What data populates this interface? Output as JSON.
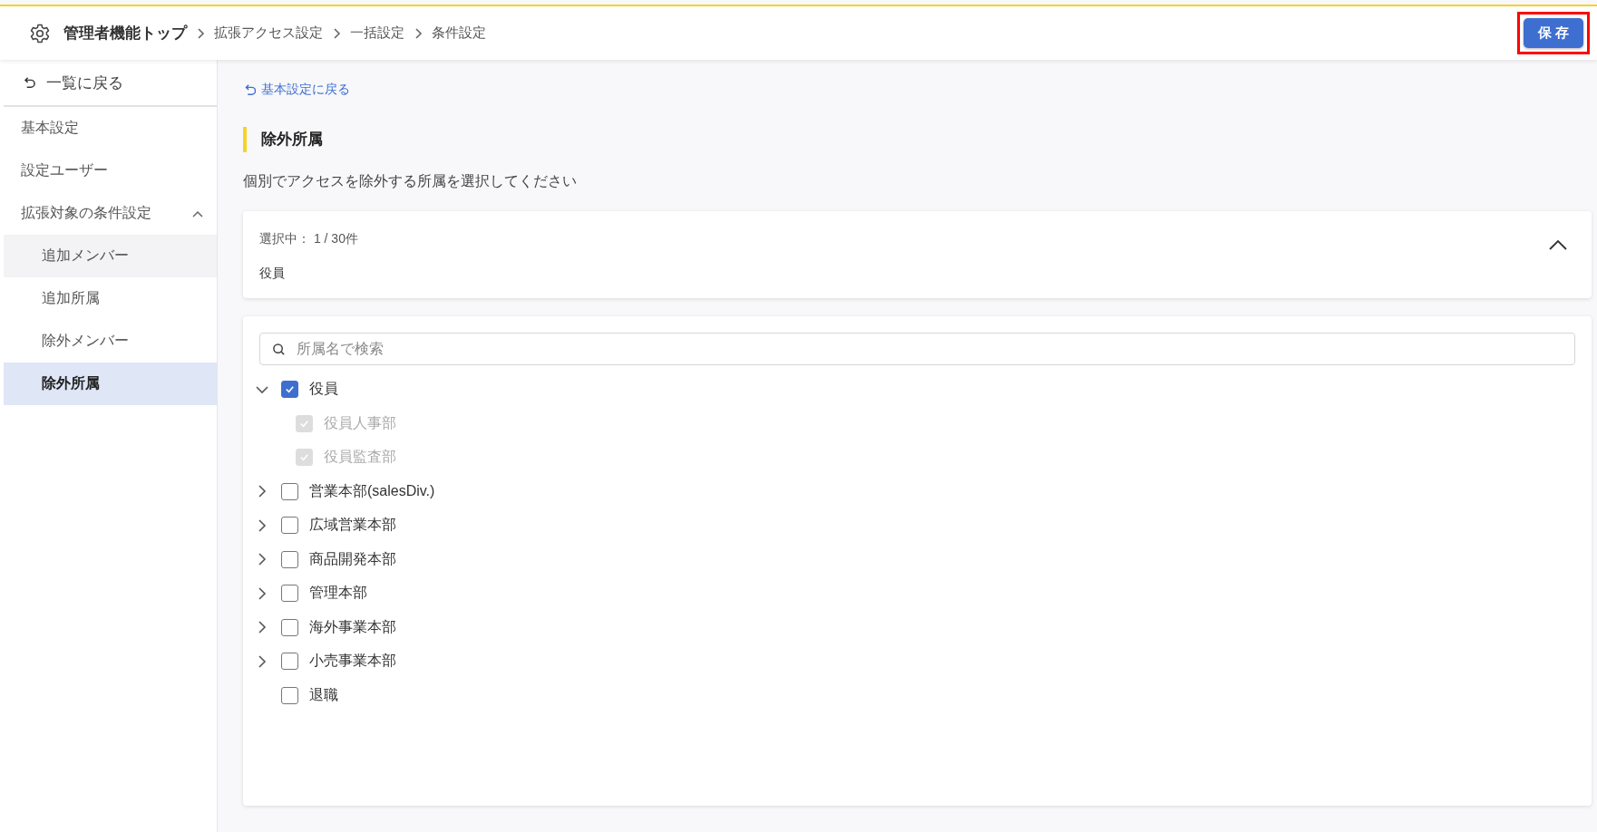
{
  "breadcrumb": [
    {
      "label": "管理者機能トップ",
      "bold": true
    },
    {
      "label": "拡張アクセス設定",
      "bold": false
    },
    {
      "label": "一括設定",
      "bold": false
    },
    {
      "label": "条件設定",
      "bold": false
    }
  ],
  "save_button": {
    "label": "保存",
    "highlighted": true
  },
  "sidebar": {
    "back_link": "一覧に戻る",
    "items": [
      {
        "label": "基本設定",
        "selected": false,
        "hovered": false
      },
      {
        "label": "設定ユーザー",
        "selected": false,
        "hovered": false
      },
      {
        "label": "拡張対象の条件設定",
        "selected": false,
        "hovered": false,
        "expanded": true,
        "children": [
          {
            "label": "追加メンバー",
            "selected": false,
            "hovered": true
          },
          {
            "label": "追加所属",
            "selected": false,
            "hovered": false
          },
          {
            "label": "除外メンバー",
            "selected": false,
            "hovered": false
          },
          {
            "label": "除外所属",
            "selected": true,
            "hovered": false
          }
        ]
      }
    ]
  },
  "back_link": "基本設定に戻る",
  "section_title": "除外所属",
  "description": "個別でアクセスを除外する所属を選択してください",
  "selection_summary": {
    "count_label": "選択中：",
    "count": "1 / 30件",
    "expanded": true,
    "items": [
      "役員"
    ]
  },
  "search": {
    "placeholder": "所属名で検索"
  },
  "tree": [
    {
      "label": "役員",
      "checked": true,
      "disabled": false,
      "expanded": true,
      "has_children": true,
      "children": [
        {
          "label": "役員人事部",
          "checked": true,
          "disabled": true,
          "has_children": false
        },
        {
          "label": "役員監査部",
          "checked": true,
          "disabled": true,
          "has_children": false
        }
      ]
    },
    {
      "label": "営業本部(salesDiv.)",
      "checked": false,
      "disabled": false,
      "expanded": false,
      "has_children": true
    },
    {
      "label": "広域営業本部",
      "checked": false,
      "disabled": false,
      "expanded": false,
      "has_children": true
    },
    {
      "label": "商品開発本部",
      "checked": false,
      "disabled": false,
      "expanded": false,
      "has_children": true
    },
    {
      "label": "管理本部",
      "checked": false,
      "disabled": false,
      "expanded": false,
      "has_children": true
    },
    {
      "label": "海外事業本部",
      "checked": false,
      "disabled": false,
      "expanded": false,
      "has_children": true
    },
    {
      "label": "小売事業本部",
      "checked": false,
      "disabled": false,
      "expanded": false,
      "has_children": true
    },
    {
      "label": "退職",
      "checked": false,
      "disabled": false,
      "has_children": false
    }
  ]
}
